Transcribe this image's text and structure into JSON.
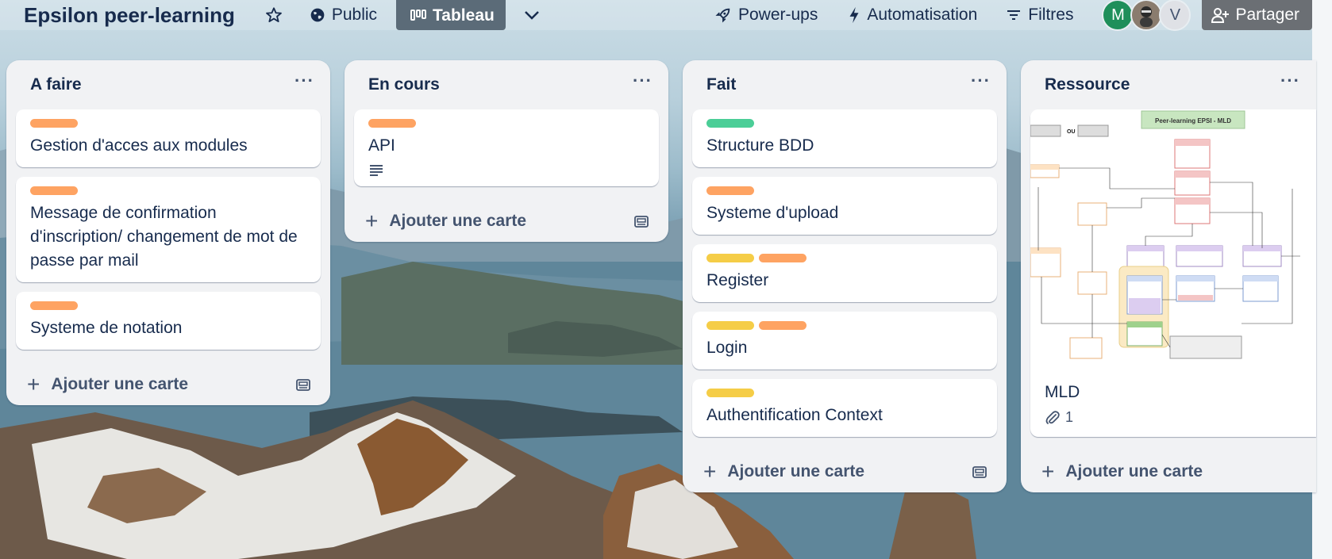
{
  "header": {
    "board_title": "Epsilon peer-learning",
    "visibility_label": "Public",
    "view_label": "Tableau",
    "powerups_label": "Power-ups",
    "automation_label": "Automatisation",
    "filters_label": "Filtres",
    "share_label": "Partager",
    "avatars": [
      {
        "initial": "M",
        "color": "#1f8f5a"
      },
      {
        "initial": "",
        "color": "#8a7c6e"
      },
      {
        "initial": "V",
        "color": "#dfe1e6",
        "text_color": "#44546f"
      }
    ]
  },
  "colors": {
    "orange": "#fea362",
    "green": "#4bce97",
    "yellow": "#f5cd47"
  },
  "lists": [
    {
      "title": "A faire",
      "menu": "···",
      "add_label": "Ajouter une carte",
      "cards": [
        {
          "labels": [
            "orange"
          ],
          "text": "Gestion d'acces aux modules"
        },
        {
          "labels": [
            "orange"
          ],
          "text": "Message de confirmation d'inscription/ changement de mot de passe par mail"
        },
        {
          "labels": [
            "orange"
          ],
          "text": "Systeme de notation"
        }
      ]
    },
    {
      "title": "En cours",
      "menu": "···",
      "add_label": "Ajouter une carte",
      "cards": [
        {
          "labels": [
            "orange"
          ],
          "text": "API",
          "has_description": true
        }
      ]
    },
    {
      "title": "Fait",
      "menu": "···",
      "add_label": "Ajouter une carte",
      "cards": [
        {
          "labels": [
            "green"
          ],
          "text": "Structure BDD"
        },
        {
          "labels": [
            "orange"
          ],
          "text": "Systeme d'upload"
        },
        {
          "labels": [
            "yellow",
            "orange"
          ],
          "text": "Register"
        },
        {
          "labels": [
            "yellow",
            "orange"
          ],
          "text": "Login"
        },
        {
          "labels": [
            "yellow"
          ],
          "text": "Authentification Context"
        }
      ]
    },
    {
      "title": "Ressource",
      "menu": "···",
      "add_label": "Ajouter une carte",
      "cards": [
        {
          "labels": [],
          "text": "MLD",
          "attachments": "1",
          "cover_title": "Peer-learning EPSI - MLD",
          "cover_or": "OU"
        }
      ]
    }
  ]
}
